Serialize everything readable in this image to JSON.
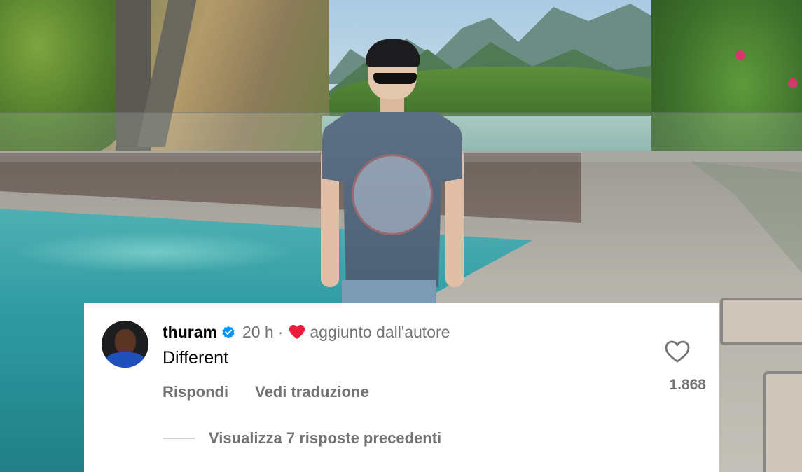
{
  "comment": {
    "username": "thuram",
    "time": "20 h",
    "separator": "·",
    "added_by_author": "aggiunto dall'autore",
    "text": "Different",
    "reply_label": "Rispondi",
    "translate_label": "Vedi traduzione",
    "like_count": "1.868",
    "view_replies_label": "Visualizza 7 risposte precedenti"
  },
  "icons": {
    "verified": "verified-badge-icon",
    "author_heart": "heart-filled-icon",
    "like": "heart-outline-icon"
  },
  "colors": {
    "verified_blue": "#0095f6",
    "heart_red": "#ed1c3a",
    "secondary_text": "#737373"
  }
}
